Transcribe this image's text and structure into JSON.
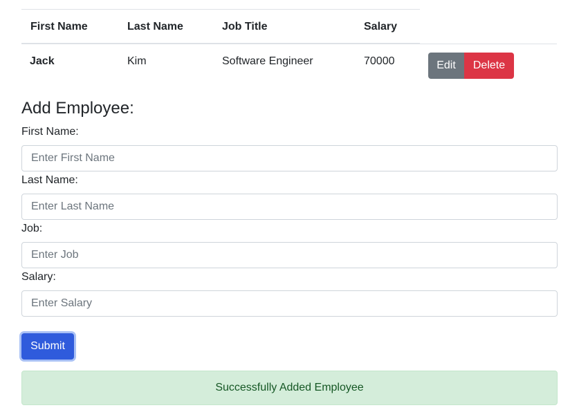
{
  "table": {
    "headers": [
      "First Name",
      "Last Name",
      "Job Title",
      "Salary"
    ],
    "rows": [
      {
        "first_name": "Jack",
        "last_name": "Kim",
        "job_title": "Software Engineer",
        "salary": "70000",
        "edit_label": "Edit",
        "delete_label": "Delete"
      }
    ]
  },
  "form": {
    "heading": "Add Employee:",
    "fields": [
      {
        "label": "First Name:",
        "placeholder": "Enter First Name",
        "value": ""
      },
      {
        "label": "Last Name:",
        "placeholder": "Enter Last Name",
        "value": ""
      },
      {
        "label": "Job:",
        "placeholder": "Enter Job",
        "value": ""
      },
      {
        "label": "Salary:",
        "placeholder": "Enter Salary",
        "value": ""
      }
    ],
    "submit_label": "Submit"
  },
  "alert": {
    "message": "Successfully Added Employee"
  },
  "colors": {
    "edit_button": "#6c757d",
    "delete_button": "#dc3545",
    "submit_button": "#2f5bdc",
    "alert_background": "#d4edda",
    "alert_text": "#155724"
  }
}
